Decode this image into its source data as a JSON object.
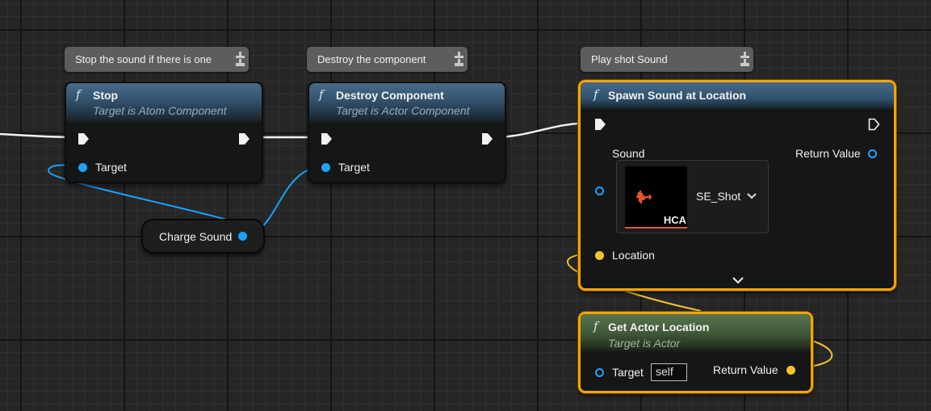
{
  "comments": {
    "stop": "Stop the sound if there is one",
    "destroy": "Destroy the component",
    "play": "Play shot Sound"
  },
  "nodes": {
    "stop": {
      "title": "Stop",
      "subtitle": "Target is Atom Component",
      "target": "Target"
    },
    "destroy": {
      "title": "Destroy Component",
      "subtitle": "Target is Actor Component",
      "target": "Target"
    },
    "spawn": {
      "title": "Spawn Sound at Location",
      "sound_label": "Sound",
      "return_label": "Return Value",
      "location_label": "Location",
      "asset_name": "SE_Shot",
      "asset_type": "HCA"
    },
    "get_location": {
      "title": "Get Actor Location",
      "subtitle": "Target is Actor",
      "target": "Target",
      "target_value": "self",
      "return_label": "Return Value"
    }
  },
  "variable": {
    "name": "Charge Sound"
  },
  "icons": {
    "function": "function-icon",
    "pin": "pin-icon",
    "exec": "exec-pin-icon",
    "dropdown": "chevron-down-icon",
    "expand": "expand-arrow-icon",
    "waveform": "waveform-icon"
  },
  "colors": {
    "object_pin": "#1aa3ff",
    "vector_pin": "#f6c32d",
    "selection": "#f6a400",
    "function_header": "#466b89",
    "pure_header": "#58744f",
    "asset_accent": "#e8552c"
  }
}
